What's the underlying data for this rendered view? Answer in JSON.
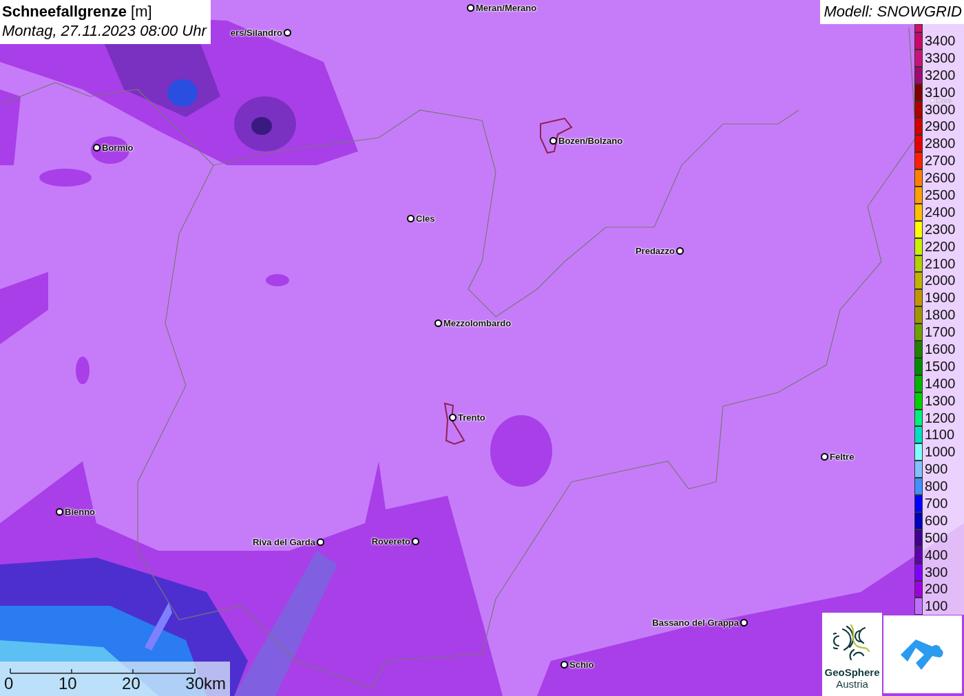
{
  "title": {
    "heading": "**Schneefallgrenze** [m]",
    "date": "Montag, 27.11.2023 08:00 Uhr"
  },
  "model": "Modell: SNOWGRID",
  "cities": [
    {
      "name": "Meran/Merano",
      "kind": "town"
    },
    {
      "name": "ers/Silandro",
      "kind": "town"
    },
    {
      "name": "Bormio",
      "kind": "town"
    },
    {
      "name": "Bozen/Bolzano",
      "kind": "town"
    },
    {
      "name": "Cles",
      "kind": "town"
    },
    {
      "name": "Predazzo",
      "kind": "town"
    },
    {
      "name": "Mezzolombardo",
      "kind": "town"
    },
    {
      "name": "Trento",
      "kind": "town"
    },
    {
      "name": "Feltre",
      "kind": "town"
    },
    {
      "name": "Bienno",
      "kind": "town"
    },
    {
      "name": "Riva del Garda",
      "kind": "town"
    },
    {
      "name": "Rovereto",
      "kind": "town"
    },
    {
      "name": "Bassano del Grappa",
      "kind": "town"
    },
    {
      "name": "Schio",
      "kind": "town"
    },
    {
      "name": "Corti",
      "kind": "faded"
    }
  ],
  "legend": [
    {
      "label": "3400",
      "color": "#c8086a"
    },
    {
      "label": "3300",
      "color": "#c81478"
    },
    {
      "label": "3200",
      "color": "#a00a70"
    },
    {
      "label": "3100",
      "color": "#800000"
    },
    {
      "label": "3000",
      "color": "#b00000"
    },
    {
      "label": "2900",
      "color": "#d00000"
    },
    {
      "label": "2800",
      "color": "#e80000"
    },
    {
      "label": "2700",
      "color": "#ff2000"
    },
    {
      "label": "2600",
      "color": "#ff8000"
    },
    {
      "label": "2500",
      "color": "#ffa000"
    },
    {
      "label": "2400",
      "color": "#ffc000"
    },
    {
      "label": "2300",
      "color": "#ffff00"
    },
    {
      "label": "2200",
      "color": "#c8f000"
    },
    {
      "label": "2100",
      "color": "#b4d200"
    },
    {
      "label": "2000",
      "color": "#c0b400"
    },
    {
      "label": "1900",
      "color": "#c09600"
    },
    {
      "label": "1800",
      "color": "#a09600"
    },
    {
      "label": "1700",
      "color": "#70a000"
    },
    {
      "label": "1600",
      "color": "#208000"
    },
    {
      "label": "1500",
      "color": "#008c00"
    },
    {
      "label": "1400",
      "color": "#00b400"
    },
    {
      "label": "1300",
      "color": "#00d200"
    },
    {
      "label": "1200",
      "color": "#00f080"
    },
    {
      "label": "1100",
      "color": "#00e0c0"
    },
    {
      "label": "1000",
      "color": "#80ffff"
    },
    {
      "label": "900",
      "color": "#80c0ff"
    },
    {
      "label": "800",
      "color": "#4090ff"
    },
    {
      "label": "700",
      "color": "#0000ff"
    },
    {
      "label": "600",
      "color": "#0000c0"
    },
    {
      "label": "500",
      "color": "#400090"
    },
    {
      "label": "400",
      "color": "#6000b0"
    },
    {
      "label": "300",
      "color": "#8000ff"
    },
    {
      "label": "200",
      "color": "#a000e0"
    },
    {
      "label": "100",
      "color": "#c070ff"
    }
  ],
  "scale": [
    "0",
    "10",
    "20",
    "30km"
  ],
  "logo": {
    "name": "GeoSphere",
    "country": "Austria"
  }
}
